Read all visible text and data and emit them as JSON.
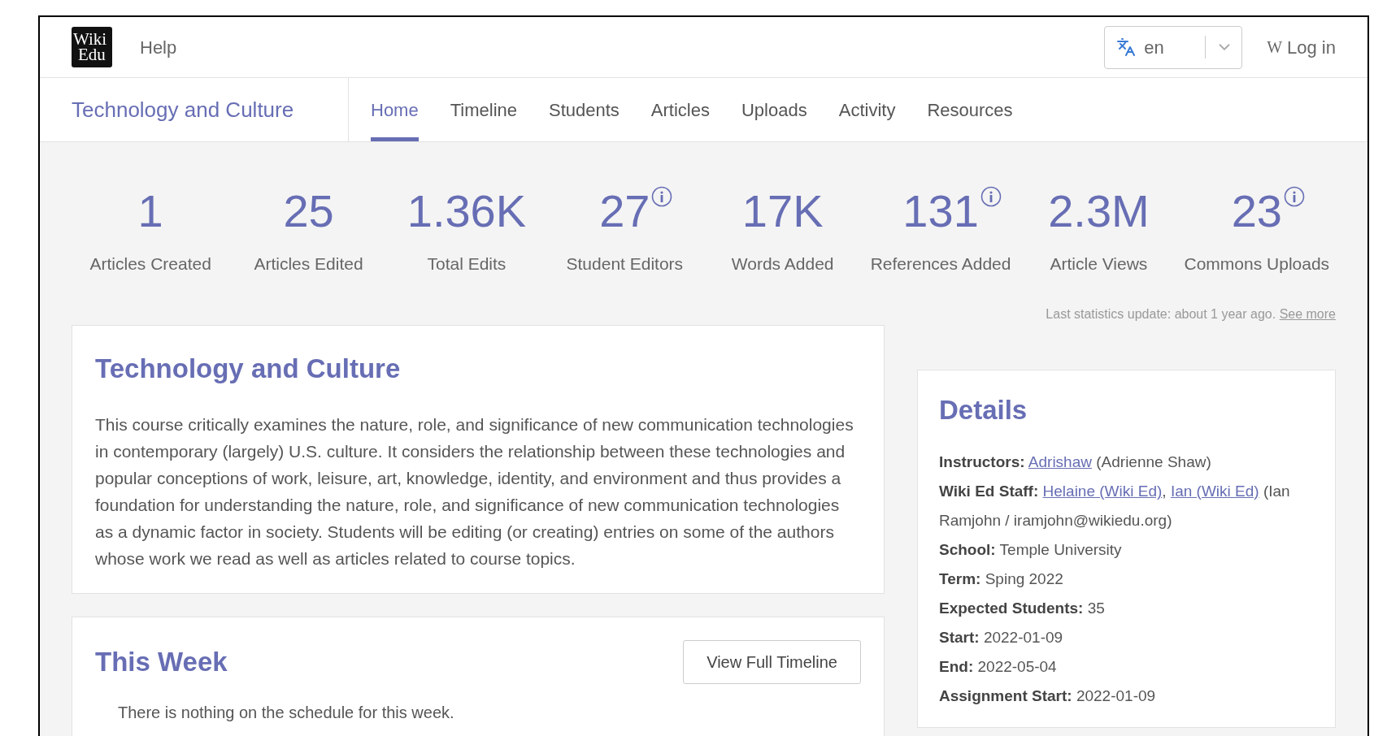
{
  "header": {
    "logo": [
      "Wiki",
      "Edu"
    ],
    "help": "Help",
    "language": {
      "value": "en"
    },
    "login": {
      "icon": "W",
      "label": "Log in"
    }
  },
  "course_title": "Technology and Culture",
  "tabs": [
    {
      "label": "Home",
      "selected": true
    },
    {
      "label": "Timeline",
      "selected": false
    },
    {
      "label": "Students",
      "selected": false
    },
    {
      "label": "Articles",
      "selected": false
    },
    {
      "label": "Uploads",
      "selected": false
    },
    {
      "label": "Activity",
      "selected": false
    },
    {
      "label": "Resources",
      "selected": false
    }
  ],
  "stats": [
    {
      "value": "1",
      "label": "Articles Created",
      "info": false
    },
    {
      "value": "25",
      "label": "Articles Edited",
      "info": false
    },
    {
      "value": "1.36K",
      "label": "Total Edits",
      "info": false
    },
    {
      "value": "27",
      "label": "Student Editors",
      "info": true
    },
    {
      "value": "17K",
      "label": "Words Added",
      "info": false
    },
    {
      "value": "131",
      "label": "References Added",
      "info": true
    },
    {
      "value": "2.3M",
      "label": "Article Views",
      "info": false
    },
    {
      "value": "23",
      "label": "Commons Uploads",
      "info": true
    }
  ],
  "stats_update": {
    "text": "Last statistics update: about 1 year ago.",
    "link": "See more"
  },
  "overview": {
    "title": "Technology and Culture",
    "description": "This course critically examines the nature, role, and significance of new communication technologies in contemporary (largely) U.S. culture. It considers the relationship between these technologies and popular conceptions of work, leisure, art, knowledge, identity, and environment and thus provides a foundation for understanding the nature, role, and significance of new communication technologies as a dynamic factor in society. Students will be editing (or creating) entries on some of the authors whose work we read as well as articles related to course topics."
  },
  "this_week": {
    "title": "This Week",
    "button": "View Full Timeline",
    "message": "There is nothing on the schedule for this week."
  },
  "details": {
    "title": "Details",
    "rows": [
      {
        "label": "Instructors:",
        "parts": [
          {
            "kind": "link",
            "text": "Adrishaw"
          },
          {
            "kind": "text",
            "text": " (Adrienne Shaw)"
          }
        ]
      },
      {
        "label": "Wiki Ed Staff:",
        "parts": [
          {
            "kind": "link",
            "text": "Helaine (Wiki Ed)"
          },
          {
            "kind": "text",
            "text": ", "
          },
          {
            "kind": "link",
            "text": "Ian (Wiki Ed)"
          },
          {
            "kind": "text",
            "text": " (Ian Ramjohn / iramjohn@wikiedu.org)"
          }
        ]
      },
      {
        "label": "School:",
        "parts": [
          {
            "kind": "text",
            "text": " Temple University"
          }
        ]
      },
      {
        "label": "Term:",
        "parts": [
          {
            "kind": "text",
            "text": " Sping 2022"
          }
        ]
      },
      {
        "label": "Expected Students:",
        "parts": [
          {
            "kind": "text",
            "text": " 35"
          }
        ]
      },
      {
        "label": "Start:",
        "parts": [
          {
            "kind": "text",
            "text": " 2022-01-09"
          }
        ]
      },
      {
        "label": "End:",
        "parts": [
          {
            "kind": "text",
            "text": " 2022-05-04"
          }
        ]
      },
      {
        "label": "Assignment Start:",
        "parts": [
          {
            "kind": "text",
            "text": " 2022-01-09"
          }
        ]
      }
    ]
  }
}
